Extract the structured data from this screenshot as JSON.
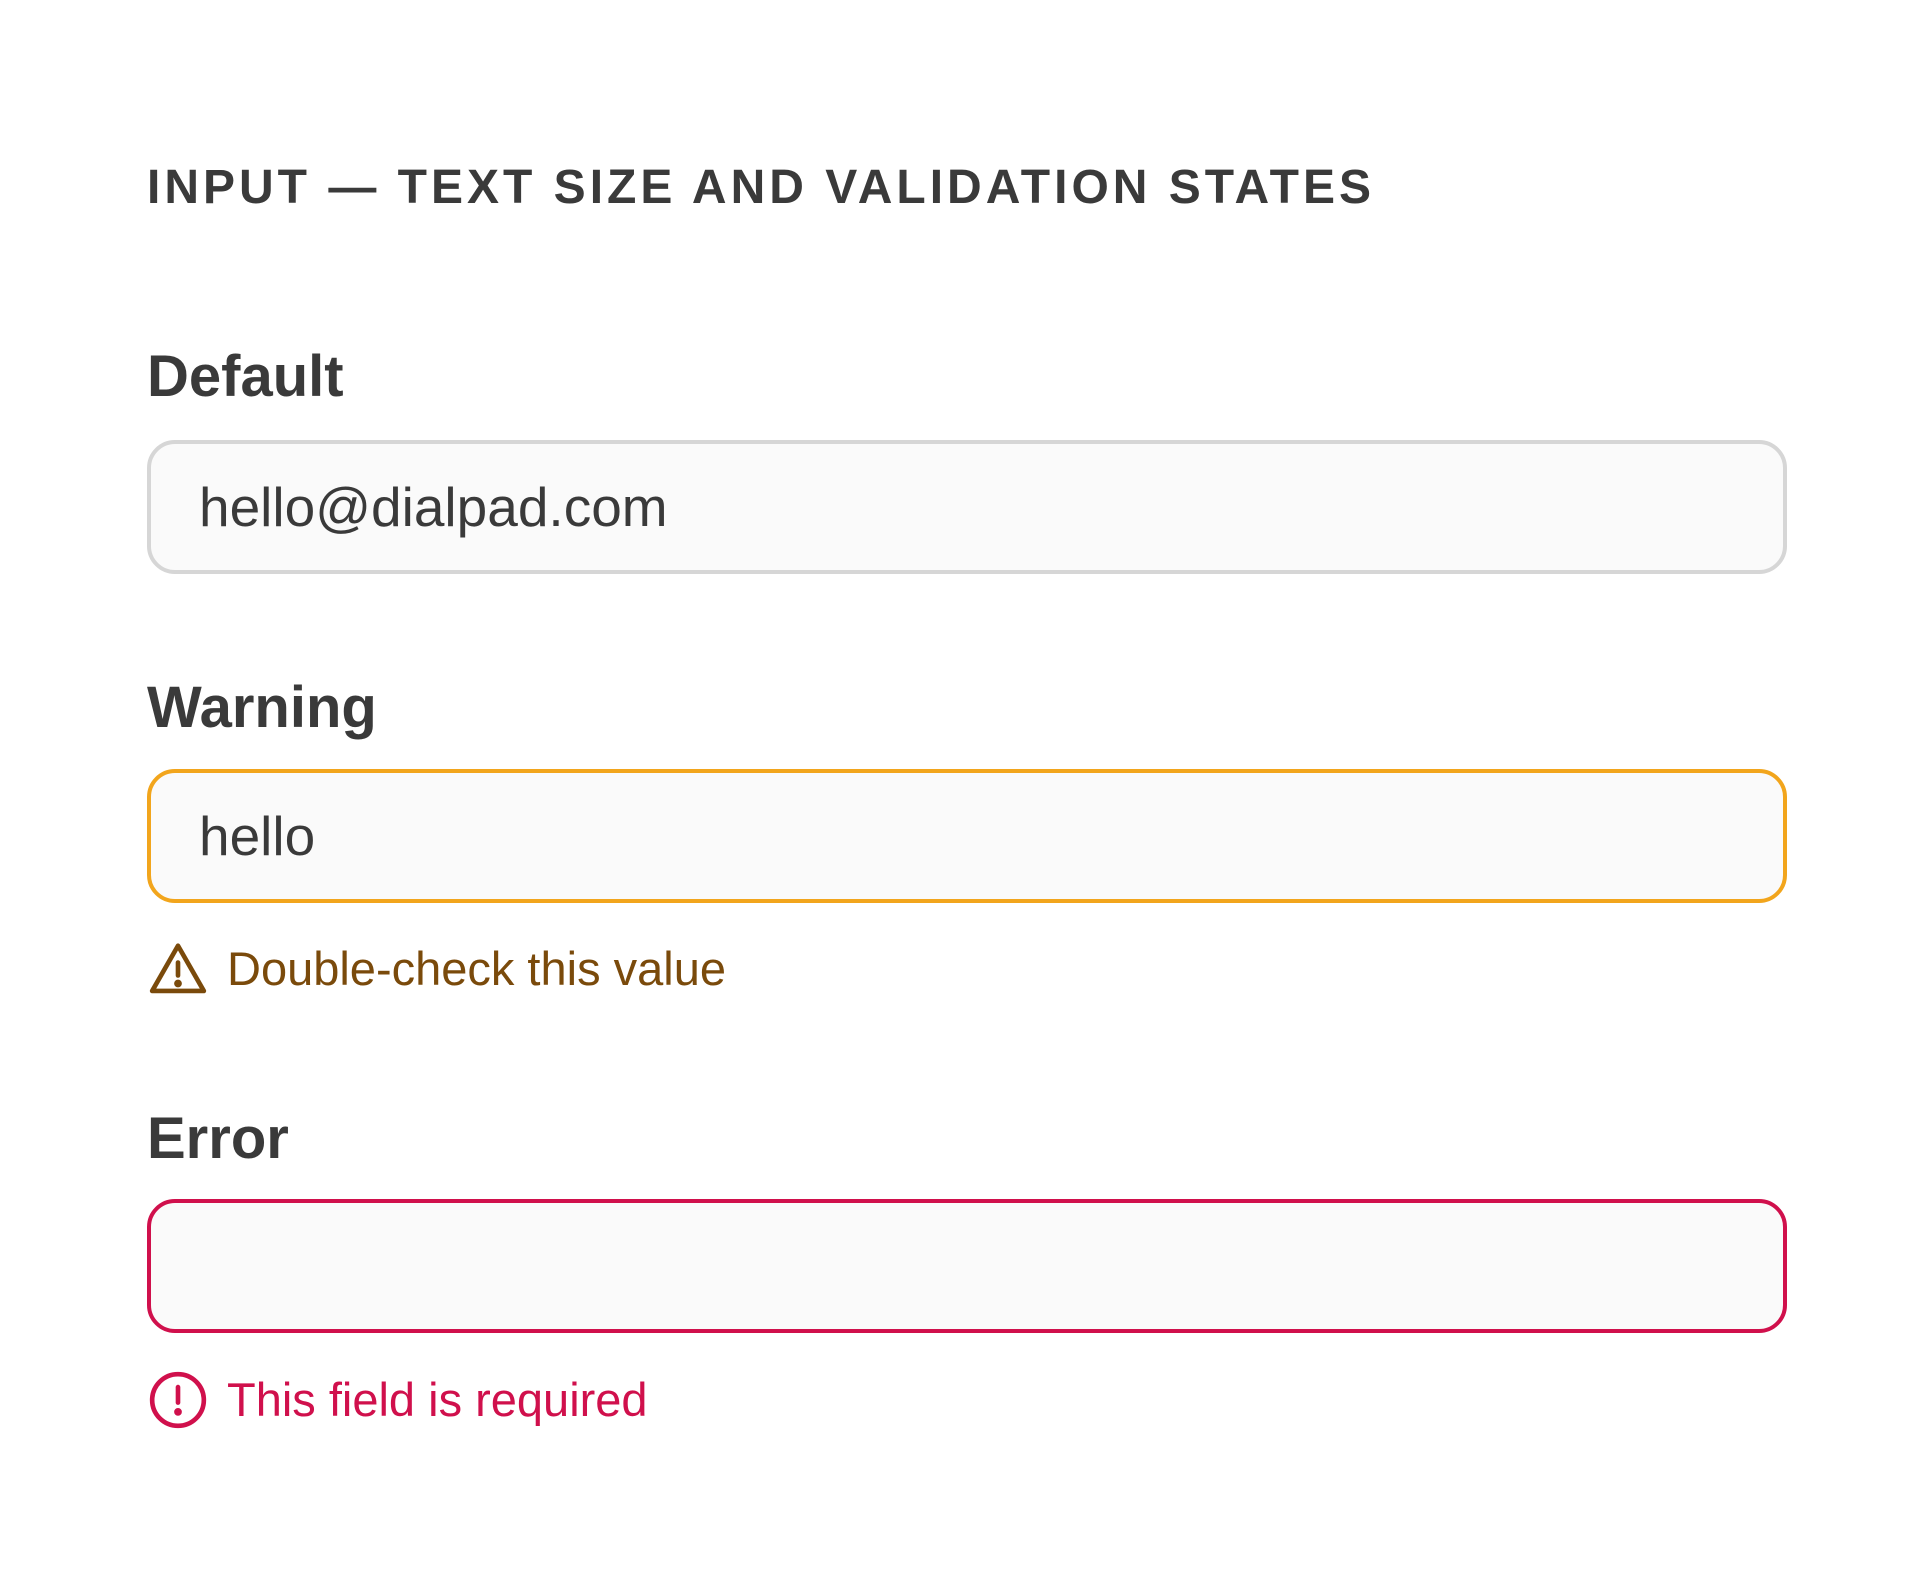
{
  "section": {
    "title": "INPUT — TEXT SIZE AND VALIDATION STATES"
  },
  "fields": {
    "default": {
      "label": "Default",
      "value": "hello@dialpad.com",
      "border_color": "#d6d6d6"
    },
    "warning": {
      "label": "Warning",
      "value": "hello",
      "border_color": "#f2a51c",
      "message": "Double-check this value",
      "message_color": "#7a4a0b",
      "icon": "warning-triangle-icon"
    },
    "error": {
      "label": "Error",
      "value": "",
      "border_color": "#d0104c",
      "message": "This field is required",
      "message_color": "#d0104c",
      "icon": "error-circle-icon"
    }
  }
}
